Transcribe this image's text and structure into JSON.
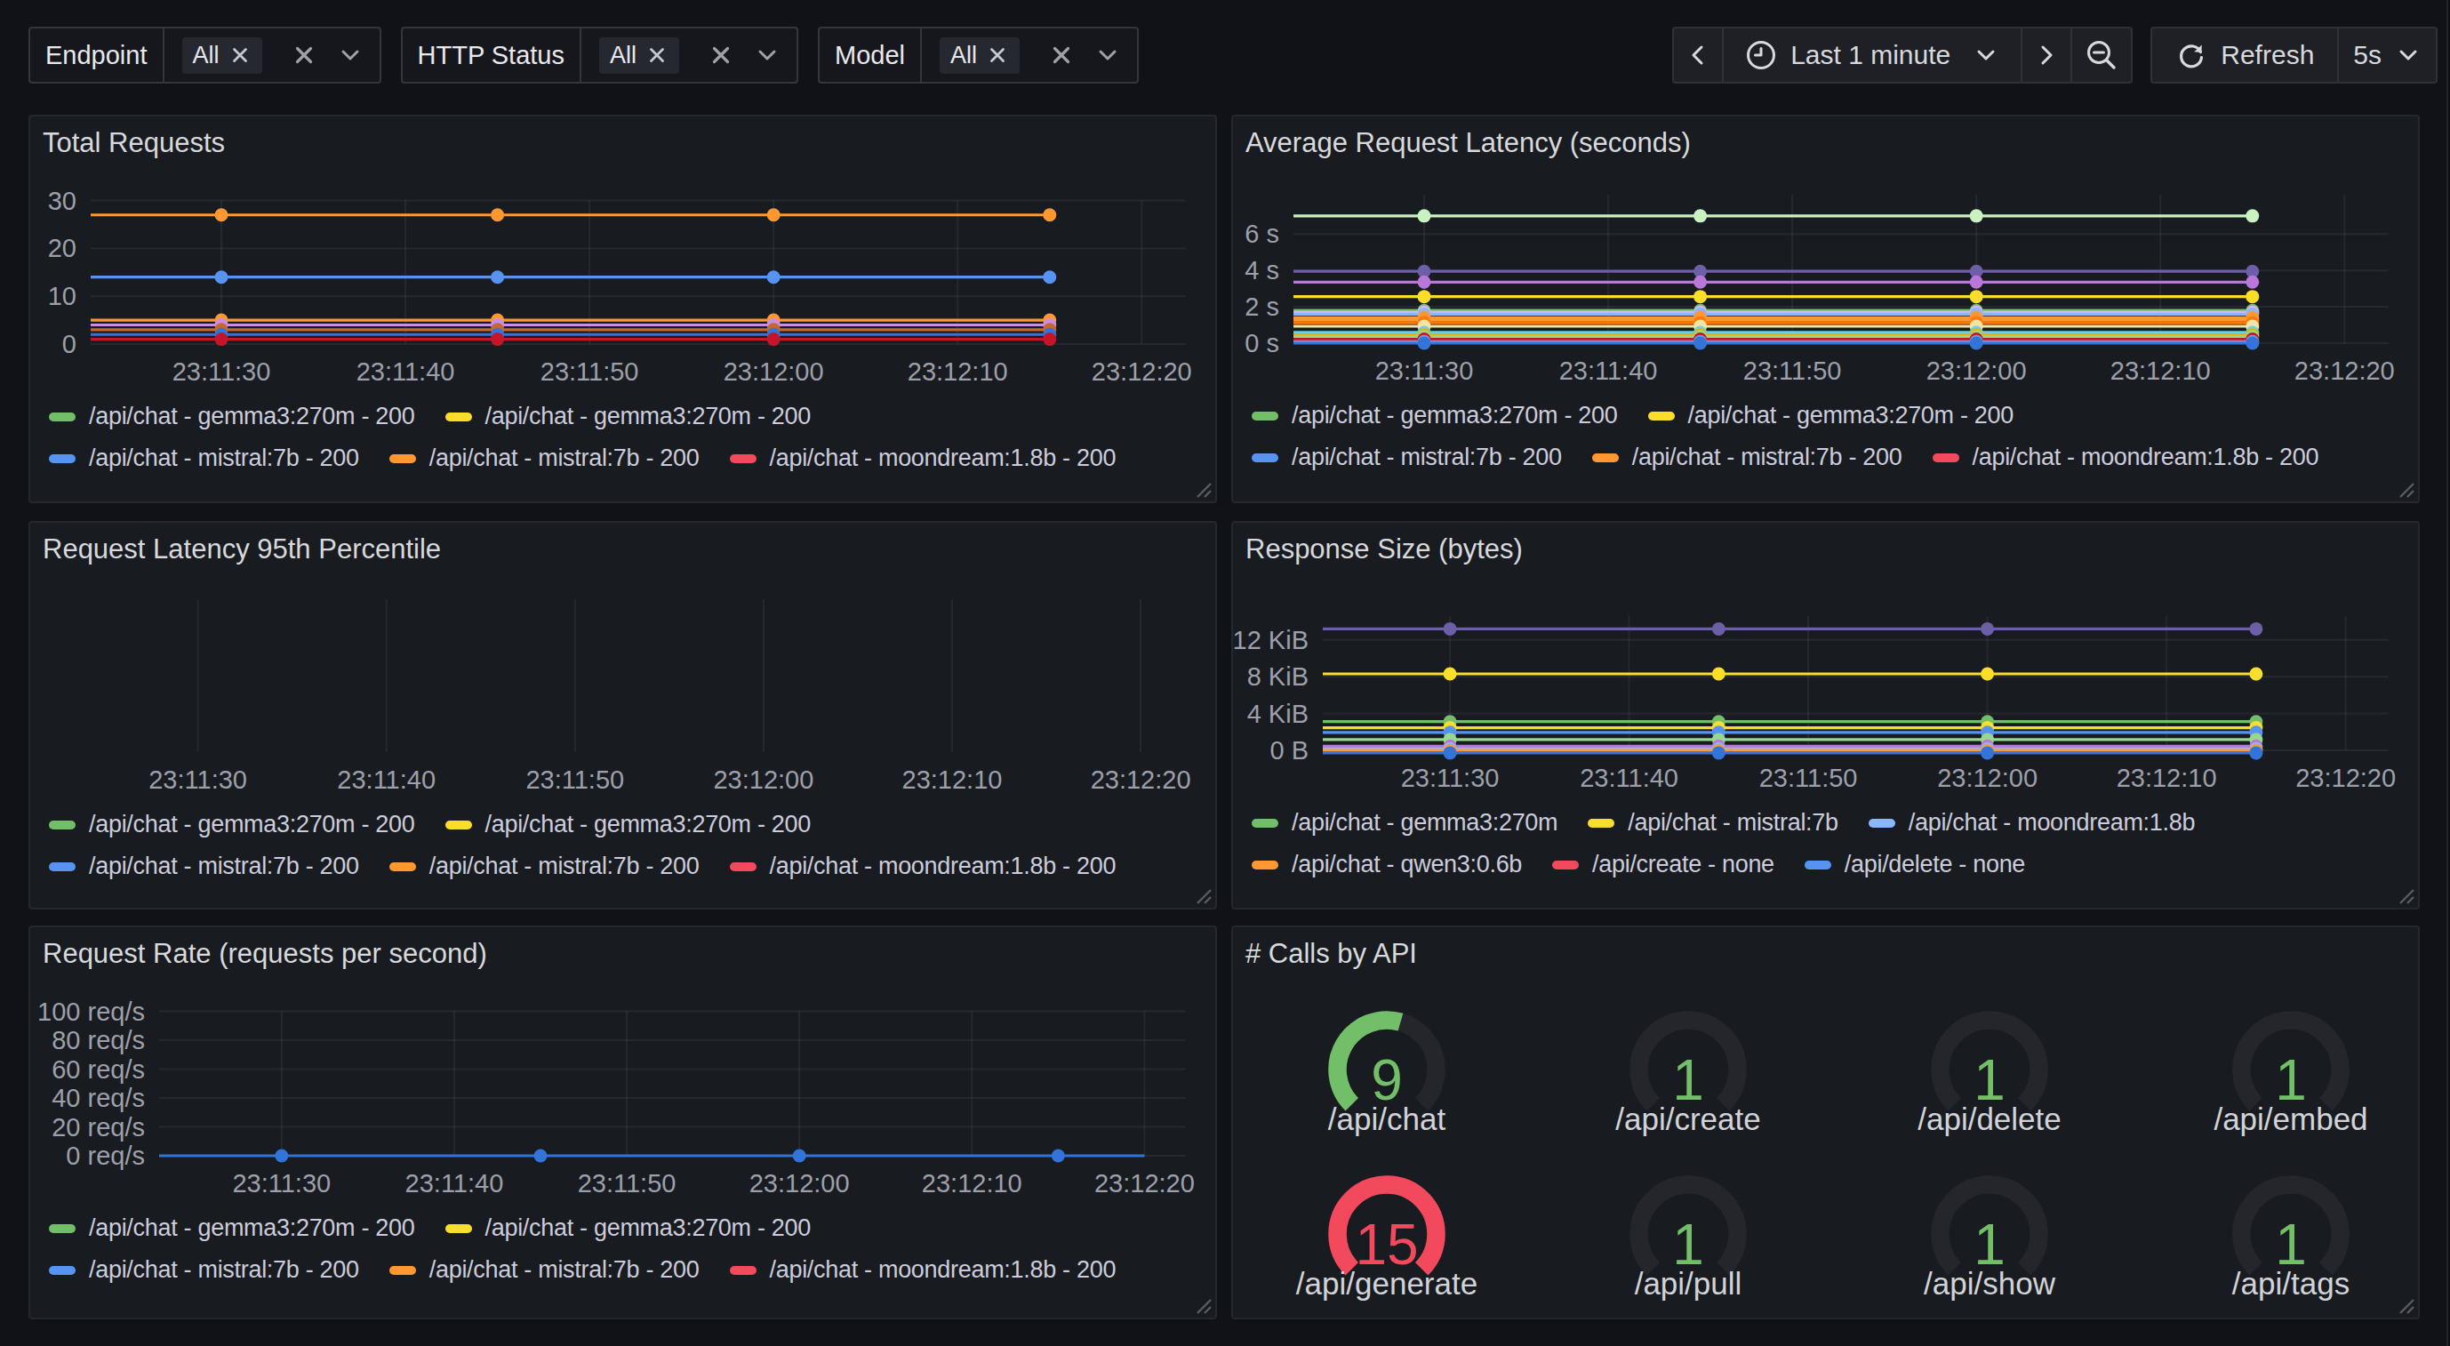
{
  "toolbar": {
    "filters": [
      {
        "label": "Endpoint",
        "selected": "All"
      },
      {
        "label": "HTTP Status",
        "selected": "All"
      },
      {
        "label": "Model",
        "selected": "All"
      }
    ],
    "time": {
      "range_label": "Last 1 minute",
      "refresh_label": "Refresh",
      "interval": "5s"
    }
  },
  "colors": {
    "background": "#111217",
    "panel": "#181b1f",
    "grid": "rgba(204,204,220,0.08)",
    "tick_text": "#9da0aa",
    "legend_text": "#ccccdc",
    "title_text": "#d8d9dc",
    "gauge_track": "#24262c",
    "green": "#73BF69",
    "red": "#F2495C"
  },
  "chart_data": [
    {
      "id": "total-requests",
      "type": "line",
      "title": "Total Requests",
      "x_ticks": [
        {
          "t": 30,
          "label": "23:11:30"
        },
        {
          "t": 40,
          "label": "23:11:40"
        },
        {
          "t": 50,
          "label": "23:11:50"
        },
        {
          "t": 60,
          "label": "23:12:00"
        },
        {
          "t": 70,
          "label": "23:12:10"
        },
        {
          "t": 80,
          "label": "23:12:20"
        }
      ],
      "xlim": [
        22.9,
        82.4
      ],
      "point_ts": [
        30,
        45,
        60,
        75
      ],
      "line_end_t": 75,
      "y_ticks": [
        {
          "v": 0,
          "label": "0"
        },
        {
          "v": 10,
          "label": "10"
        },
        {
          "v": 20,
          "label": "20"
        },
        {
          "v": 30,
          "label": "30"
        }
      ],
      "series": [
        {
          "color": "#FF9830",
          "value": 27
        },
        {
          "color": "#5794F2",
          "value": 14
        },
        {
          "color": "#FF9830",
          "value": 5
        },
        {
          "color": "#CA8EE5",
          "value": 4
        },
        {
          "color": "#C4682C",
          "value": 3
        },
        {
          "color": "#3274D9",
          "value": 2
        },
        {
          "color": "#C4162A",
          "value": 1
        }
      ],
      "legend_rows": [
        [
          {
            "color": "#73BF69",
            "label": "/api/chat - gemma3:270m - 200"
          },
          {
            "color": "#FADE2A",
            "label": "/api/chat - gemma3:270m - 200"
          }
        ],
        [
          {
            "color": "#5794F2",
            "label": "/api/chat - mistral:7b - 200"
          },
          {
            "color": "#FF9830",
            "label": "/api/chat - mistral:7b - 200"
          },
          {
            "color": "#F2495C",
            "label": "/api/chat - moondream:1.8b - 200"
          }
        ]
      ]
    },
    {
      "id": "avg-latency",
      "type": "line",
      "title": "Average Request Latency (seconds)",
      "x_ticks": [
        {
          "t": 30,
          "label": "23:11:30"
        },
        {
          "t": 40,
          "label": "23:11:40"
        },
        {
          "t": 50,
          "label": "23:11:50"
        },
        {
          "t": 60,
          "label": "23:12:00"
        },
        {
          "t": 70,
          "label": "23:12:10"
        },
        {
          "t": 80,
          "label": "23:12:20"
        }
      ],
      "xlim": [
        22.9,
        82.4
      ],
      "point_ts": [
        30,
        45,
        60,
        75
      ],
      "line_end_t": 75,
      "y_ticks": [
        {
          "v": 0,
          "label": "0 s"
        },
        {
          "v": 2,
          "label": "2 s"
        },
        {
          "v": 4,
          "label": "4 s"
        },
        {
          "v": 6,
          "label": "6 s"
        }
      ],
      "series": [
        {
          "color": "#C8F2C2",
          "value": 7.0
        },
        {
          "color": "#6C5FA7",
          "value": 3.95
        },
        {
          "color": "#B877D9",
          "value": 3.36
        },
        {
          "color": "#FADE2A",
          "value": 2.56
        },
        {
          "color": "#73BF69",
          "value": 1.8
        },
        {
          "color": "#DEB6F2",
          "value": 1.7
        },
        {
          "color": "#8AB8FF",
          "value": 1.6
        },
        {
          "color": "#FF9830",
          "value": 1.4
        },
        {
          "color": "#FF9830",
          "value": 1.26
        },
        {
          "color": "#FF780A",
          "value": 1.12
        },
        {
          "color": "#F3E5A4",
          "value": 0.93
        },
        {
          "color": "#6ED0E0",
          "value": 0.59
        },
        {
          "color": "#E0B400",
          "value": 0.46
        },
        {
          "color": "#96D98D",
          "value": 0.35
        },
        {
          "color": "#C4162A",
          "value": 0.22
        },
        {
          "color": "#7E9BE0",
          "value": 0.08
        },
        {
          "color": "#3274D9",
          "value": 0.0
        }
      ],
      "legend_rows": [
        [
          {
            "color": "#73BF69",
            "label": "/api/chat - gemma3:270m - 200"
          },
          {
            "color": "#FADE2A",
            "label": "/api/chat - gemma3:270m - 200"
          }
        ],
        [
          {
            "color": "#5794F2",
            "label": "/api/chat - mistral:7b - 200"
          },
          {
            "color": "#FF9830",
            "label": "/api/chat - mistral:7b - 200"
          },
          {
            "color": "#F2495C",
            "label": "/api/chat - moondream:1.8b - 200"
          }
        ]
      ]
    },
    {
      "id": "latency-p95",
      "type": "line",
      "title": "Request Latency 95th Percentile",
      "x_ticks": [
        {
          "t": 30,
          "label": "23:11:30"
        },
        {
          "t": 40,
          "label": "23:11:40"
        },
        {
          "t": 50,
          "label": "23:11:50"
        },
        {
          "t": 60,
          "label": "23:12:00"
        },
        {
          "t": 70,
          "label": "23:12:10"
        },
        {
          "t": 80,
          "label": "23:12:20"
        }
      ],
      "xlim": [
        22.9,
        82.4
      ],
      "point_ts": [],
      "line_end_t": null,
      "y_ticks": [],
      "series": [],
      "legend_rows": [
        [
          {
            "color": "#73BF69",
            "label": "/api/chat - gemma3:270m - 200"
          },
          {
            "color": "#FADE2A",
            "label": "/api/chat - gemma3:270m - 200"
          }
        ],
        [
          {
            "color": "#5794F2",
            "label": "/api/chat - mistral:7b - 200"
          },
          {
            "color": "#FF9830",
            "label": "/api/chat - mistral:7b - 200"
          },
          {
            "color": "#F2495C",
            "label": "/api/chat - moondream:1.8b - 200"
          }
        ]
      ]
    },
    {
      "id": "response-size",
      "type": "line",
      "title": "Response Size (bytes)",
      "x_ticks": [
        {
          "t": 30,
          "label": "23:11:30"
        },
        {
          "t": 40,
          "label": "23:11:40"
        },
        {
          "t": 50,
          "label": "23:11:50"
        },
        {
          "t": 60,
          "label": "23:12:00"
        },
        {
          "t": 70,
          "label": "23:12:10"
        },
        {
          "t": 80,
          "label": "23:12:20"
        }
      ],
      "xlim": [
        22.9,
        82.4
      ],
      "point_ts": [
        30,
        45,
        60,
        75
      ],
      "line_end_t": 75,
      "y_ticks": [
        {
          "v": 0,
          "label": "0 B"
        },
        {
          "v": 4,
          "label": "4 KiB"
        },
        {
          "v": 8,
          "label": "8 KiB"
        },
        {
          "v": 12,
          "label": "12 KiB"
        }
      ],
      "series": [
        {
          "color": "#6C5FA7",
          "value": 13.2
        },
        {
          "color": "#FADE2A",
          "value": 8.31
        },
        {
          "color": "#73BF69",
          "value": 3.12
        },
        {
          "color": "#FADE2A",
          "value": 2.46
        },
        {
          "color": "#5794F2",
          "value": 1.95
        },
        {
          "color": "#96D98D",
          "value": 1.17
        },
        {
          "color": "#B877D9",
          "value": 0.45
        },
        {
          "color": "#8AB8FF",
          "value": 0.17
        },
        {
          "color": "#FF9830",
          "value": -0.02
        },
        {
          "color": "#3274D9",
          "value": -0.28
        }
      ],
      "legend_rows": [
        [
          {
            "color": "#73BF69",
            "label": "/api/chat - gemma3:270m"
          },
          {
            "color": "#FADE2A",
            "label": "/api/chat - mistral:7b"
          },
          {
            "color": "#8AB8FF",
            "label": "/api/chat - moondream:1.8b"
          }
        ],
        [
          {
            "color": "#FF9830",
            "label": "/api/chat - qwen3:0.6b"
          },
          {
            "color": "#F2495C",
            "label": "/api/create - none"
          },
          {
            "color": "#5794F2",
            "label": "/api/delete - none"
          }
        ]
      ]
    },
    {
      "id": "request-rate",
      "type": "line",
      "title": "Request Rate (requests per second)",
      "x_ticks": [
        {
          "t": 30,
          "label": "23:11:30"
        },
        {
          "t": 40,
          "label": "23:11:40"
        },
        {
          "t": 50,
          "label": "23:11:50"
        },
        {
          "t": 60,
          "label": "23:12:00"
        },
        {
          "t": 70,
          "label": "23:12:10"
        },
        {
          "t": 80,
          "label": "23:12:20"
        }
      ],
      "xlim": [
        22.9,
        82.4
      ],
      "point_ts": [
        30,
        45,
        60,
        75
      ],
      "line_end_t": 80,
      "y_ticks": [
        {
          "v": 0,
          "label": "0 req/s"
        },
        {
          "v": 20,
          "label": "20 req/s"
        },
        {
          "v": 40,
          "label": "40 req/s"
        },
        {
          "v": 60,
          "label": "60 req/s"
        },
        {
          "v": 80,
          "label": "80 req/s"
        },
        {
          "v": 100,
          "label": "100 req/s"
        }
      ],
      "series": [
        {
          "color": "#3274D9",
          "value": 0
        }
      ],
      "legend_rows": [
        [
          {
            "color": "#73BF69",
            "label": "/api/chat - gemma3:270m - 200"
          },
          {
            "color": "#FADE2A",
            "label": "/api/chat - gemma3:270m - 200"
          }
        ],
        [
          {
            "color": "#5794F2",
            "label": "/api/chat - mistral:7b - 200"
          },
          {
            "color": "#FF9830",
            "label": "/api/chat - mistral:7b - 200"
          },
          {
            "color": "#F2495C",
            "label": "/api/chat - moondream:1.8b - 200"
          }
        ]
      ]
    },
    {
      "id": "calls-by-api",
      "type": "gauge",
      "title": "# Calls by API",
      "gauges": [
        {
          "label": "/api/chat",
          "value": "9",
          "fill": 0.56,
          "color": "#73BF69"
        },
        {
          "label": "/api/create",
          "value": "1",
          "fill": 0,
          "color": "#73BF69"
        },
        {
          "label": "/api/delete",
          "value": "1",
          "fill": 0,
          "color": "#73BF69"
        },
        {
          "label": "/api/embed",
          "value": "1",
          "fill": 0,
          "color": "#73BF69"
        },
        {
          "label": "/api/generate",
          "value": "15",
          "fill": 1,
          "color": "#F2495C"
        },
        {
          "label": "/api/pull",
          "value": "1",
          "fill": 0,
          "color": "#73BF69"
        },
        {
          "label": "/api/show",
          "value": "1",
          "fill": 0,
          "color": "#73BF69"
        },
        {
          "label": "/api/tags",
          "value": "1",
          "fill": 0,
          "color": "#73BF69"
        }
      ]
    }
  ]
}
